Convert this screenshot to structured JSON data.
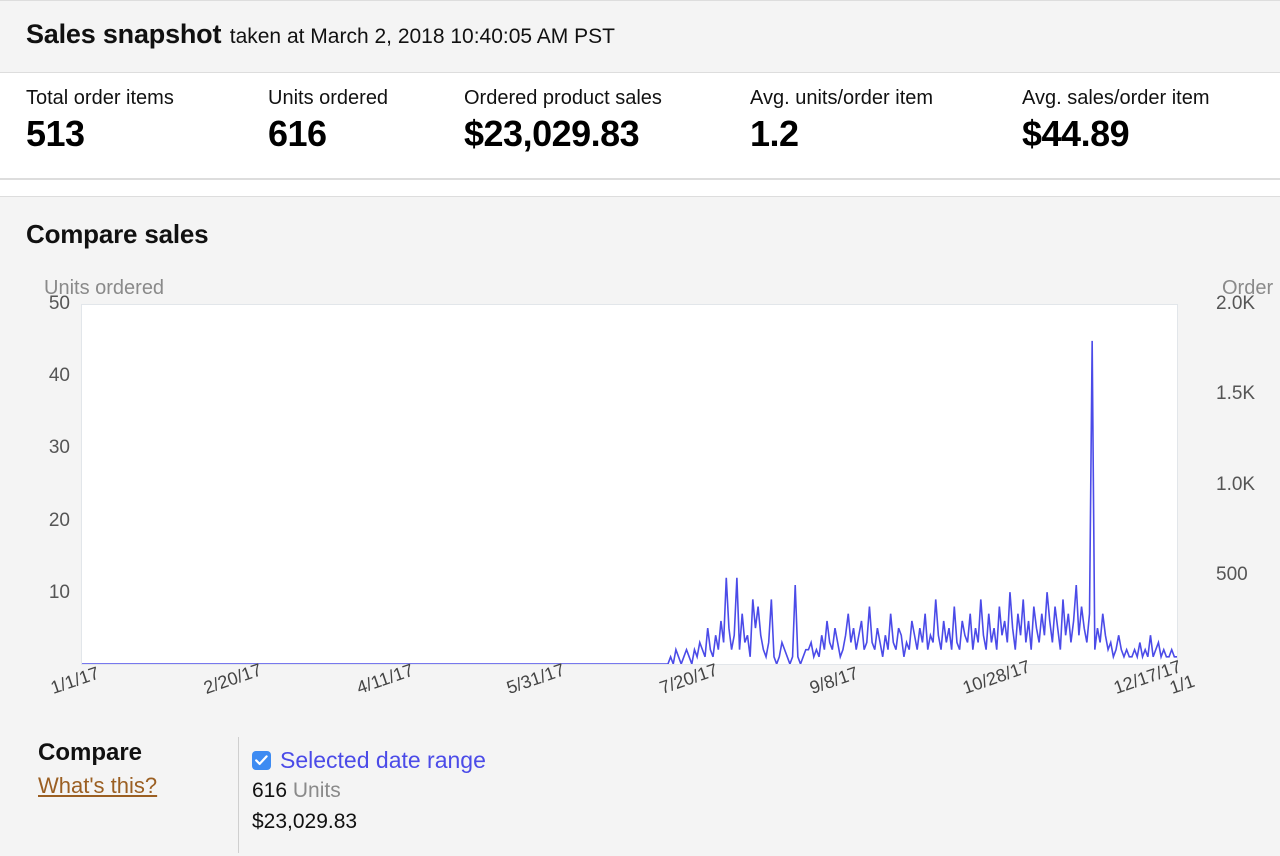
{
  "snapshot": {
    "title": "Sales snapshot",
    "subtitle": "taken at March 2, 2018 10:40:05 AM PST",
    "metrics": [
      {
        "label": "Total order items",
        "value": "513"
      },
      {
        "label": "Units ordered",
        "value": "616"
      },
      {
        "label": "Ordered product sales",
        "value": "$23,029.83"
      },
      {
        "label": "Avg. units/order item",
        "value": "1.2"
      },
      {
        "label": "Avg. sales/order item",
        "value": "$44.89"
      }
    ]
  },
  "compare": {
    "title": "Compare sales",
    "footer_heading": "Compare",
    "whats_this": "What's this?",
    "legend": {
      "checkbox_checked": true,
      "label": "Selected date range",
      "units_value": "616",
      "units_word": "Units",
      "sales_value": "$23,029.83",
      "accent_color": "#4b4be8",
      "checkbox_color": "#3d8bf2"
    }
  },
  "chart_data": {
    "type": "line",
    "title": "Compare sales",
    "series": [
      {
        "name": "Selected date range",
        "axis": "left",
        "color": "#4b4be8",
        "units_total": 616,
        "sales_total": "$23,029.83"
      }
    ],
    "left_axis": {
      "label": "Units ordered",
      "ticks": [
        "50",
        "40",
        "30",
        "20",
        "10"
      ],
      "tick_values": [
        50,
        40,
        30,
        20,
        10
      ],
      "ylim": [
        0,
        50
      ]
    },
    "right_axis": {
      "label": "Order",
      "label_full": "Ordered product sales",
      "ticks": [
        "2.0K",
        "1.5K",
        "1.0K",
        "500"
      ],
      "tick_values": [
        2000,
        1500,
        1000,
        500
      ],
      "ylim": [
        0,
        2000
      ]
    },
    "x_ticks": [
      "1/1/17",
      "2/20/17",
      "4/11/17",
      "5/31/17",
      "7/20/17",
      "9/8/17",
      "10/28/17",
      "12/17/17",
      "1/1"
    ],
    "x_tick_positions": [
      0,
      0.1395,
      0.2791,
      0.4158,
      0.5554,
      0.6922,
      0.8318,
      0.9686,
      1.02
    ],
    "grid": false,
    "legend_position": "bottom",
    "xlabel": "",
    "ylabel": "Units ordered",
    "values": [
      0,
      0,
      0,
      0,
      0,
      0,
      0,
      0,
      0,
      0,
      0,
      0,
      0,
      0,
      0,
      0,
      0,
      0,
      0,
      0,
      0,
      0,
      0,
      0,
      0,
      0,
      0,
      0,
      0,
      0,
      0,
      0,
      0,
      0,
      0,
      0,
      0,
      0,
      0,
      0,
      0,
      0,
      0,
      0,
      0,
      0,
      0,
      0,
      0,
      0,
      0,
      0,
      0,
      0,
      0,
      0,
      0,
      0,
      0,
      0,
      0,
      0,
      0,
      0,
      0,
      0,
      0,
      0,
      0,
      0,
      0,
      0,
      0,
      0,
      0,
      0,
      0,
      0,
      0,
      0,
      0,
      0,
      0,
      0,
      0,
      0,
      0,
      0,
      0,
      0,
      0,
      0,
      0,
      0,
      0,
      0,
      0,
      0,
      0,
      0,
      0,
      0,
      0,
      0,
      0,
      0,
      0,
      0,
      0,
      0,
      0,
      0,
      0,
      0,
      0,
      0,
      0,
      0,
      0,
      0,
      0,
      0,
      0,
      0,
      0,
      0,
      0,
      0,
      0,
      0,
      0,
      0,
      0,
      0,
      0,
      0,
      0,
      0,
      0,
      0,
      0,
      0,
      0,
      0,
      0,
      0,
      0,
      0,
      0,
      0,
      0,
      0,
      0,
      0,
      0,
      0,
      0,
      0,
      0,
      0,
      0,
      0,
      0,
      0,
      0,
      0,
      0,
      0,
      0,
      0,
      0,
      0,
      0,
      0,
      0,
      0,
      0,
      0,
      0,
      0,
      0,
      0,
      0,
      0,
      0,
      0,
      0,
      0,
      0,
      0,
      0,
      0,
      0,
      0,
      0,
      0,
      0,
      0,
      0,
      0,
      0,
      0,
      0,
      0,
      0,
      0,
      0,
      0,
      0,
      0,
      0,
      0,
      0,
      0,
      0,
      0,
      0,
      0,
      0,
      0,
      0,
      0,
      1,
      0,
      2,
      1,
      0,
      1,
      2,
      1,
      0,
      2,
      1,
      3,
      2,
      1,
      5,
      2,
      1,
      4,
      2,
      6,
      3,
      12,
      5,
      2,
      4,
      12,
      2,
      7,
      3,
      4,
      1,
      9,
      5,
      8,
      4,
      2,
      1,
      3,
      9,
      1,
      0,
      1,
      3,
      2,
      1,
      0,
      1,
      11,
      1,
      0,
      1,
      2,
      2,
      3,
      1,
      2,
      1,
      4,
      2,
      6,
      3,
      2,
      5,
      3,
      1,
      2,
      4,
      7,
      3,
      5,
      2,
      4,
      6,
      2,
      3,
      8,
      3,
      2,
      5,
      3,
      1,
      4,
      2,
      7,
      3,
      2,
      5,
      4,
      1,
      3,
      2,
      6,
      4,
      2,
      5,
      3,
      7,
      2,
      4,
      3,
      9,
      4,
      2,
      6,
      3,
      5,
      2,
      8,
      3,
      2,
      6,
      4,
      3,
      7,
      2,
      5,
      3,
      9,
      4,
      2,
      7,
      3,
      5,
      2,
      8,
      4,
      6,
      3,
      10,
      5,
      2,
      7,
      4,
      9,
      3,
      6,
      2,
      8,
      5,
      3,
      7,
      4,
      10,
      6,
      3,
      8,
      5,
      2,
      9,
      4,
      7,
      3,
      6,
      11,
      4,
      8,
      5,
      3,
      7,
      45,
      2,
      5,
      3,
      7,
      4,
      2,
      3,
      1,
      2,
      4,
      2,
      1,
      2,
      1,
      1,
      2,
      1,
      3,
      1,
      2,
      1,
      4,
      1,
      2,
      3,
      1,
      2,
      1,
      1,
      2,
      1,
      1
    ]
  }
}
